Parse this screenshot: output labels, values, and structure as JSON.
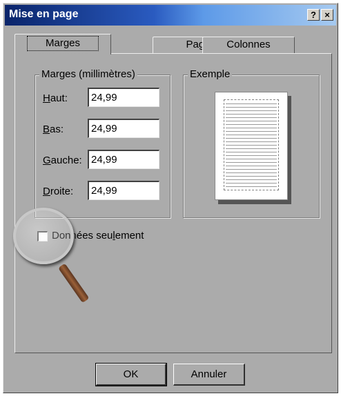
{
  "window": {
    "title": "Mise en page"
  },
  "titlebar": {
    "help_label": "?",
    "close_label": "×"
  },
  "tabs": [
    {
      "label": "Marges",
      "active": true
    },
    {
      "label": "Page",
      "active": false
    },
    {
      "label": "Colonnes",
      "active": false
    }
  ],
  "margins": {
    "group_label": "Marges (millimètres)",
    "fields": [
      {
        "label_first": "H",
        "label_rest": "aut:",
        "value": "24,99"
      },
      {
        "label_first": "B",
        "label_rest": "as:",
        "value": "24,99"
      },
      {
        "label_first": "G",
        "label_rest": "auche:",
        "value": "24,99"
      },
      {
        "label_first": "D",
        "label_rest": "roite:",
        "value": "24,99"
      }
    ]
  },
  "example": {
    "group_label": "Exemple"
  },
  "data_only": {
    "label_part1": "Données seu",
    "label_underline": "l",
    "label_part2": "ement",
    "checked": false
  },
  "buttons": {
    "ok_label": "OK",
    "cancel_label": "Annuler"
  },
  "colors": {
    "dialog_bg": "#ababab",
    "titlebar_start": "#0a246a",
    "titlebar_end": "#a6caf0"
  }
}
